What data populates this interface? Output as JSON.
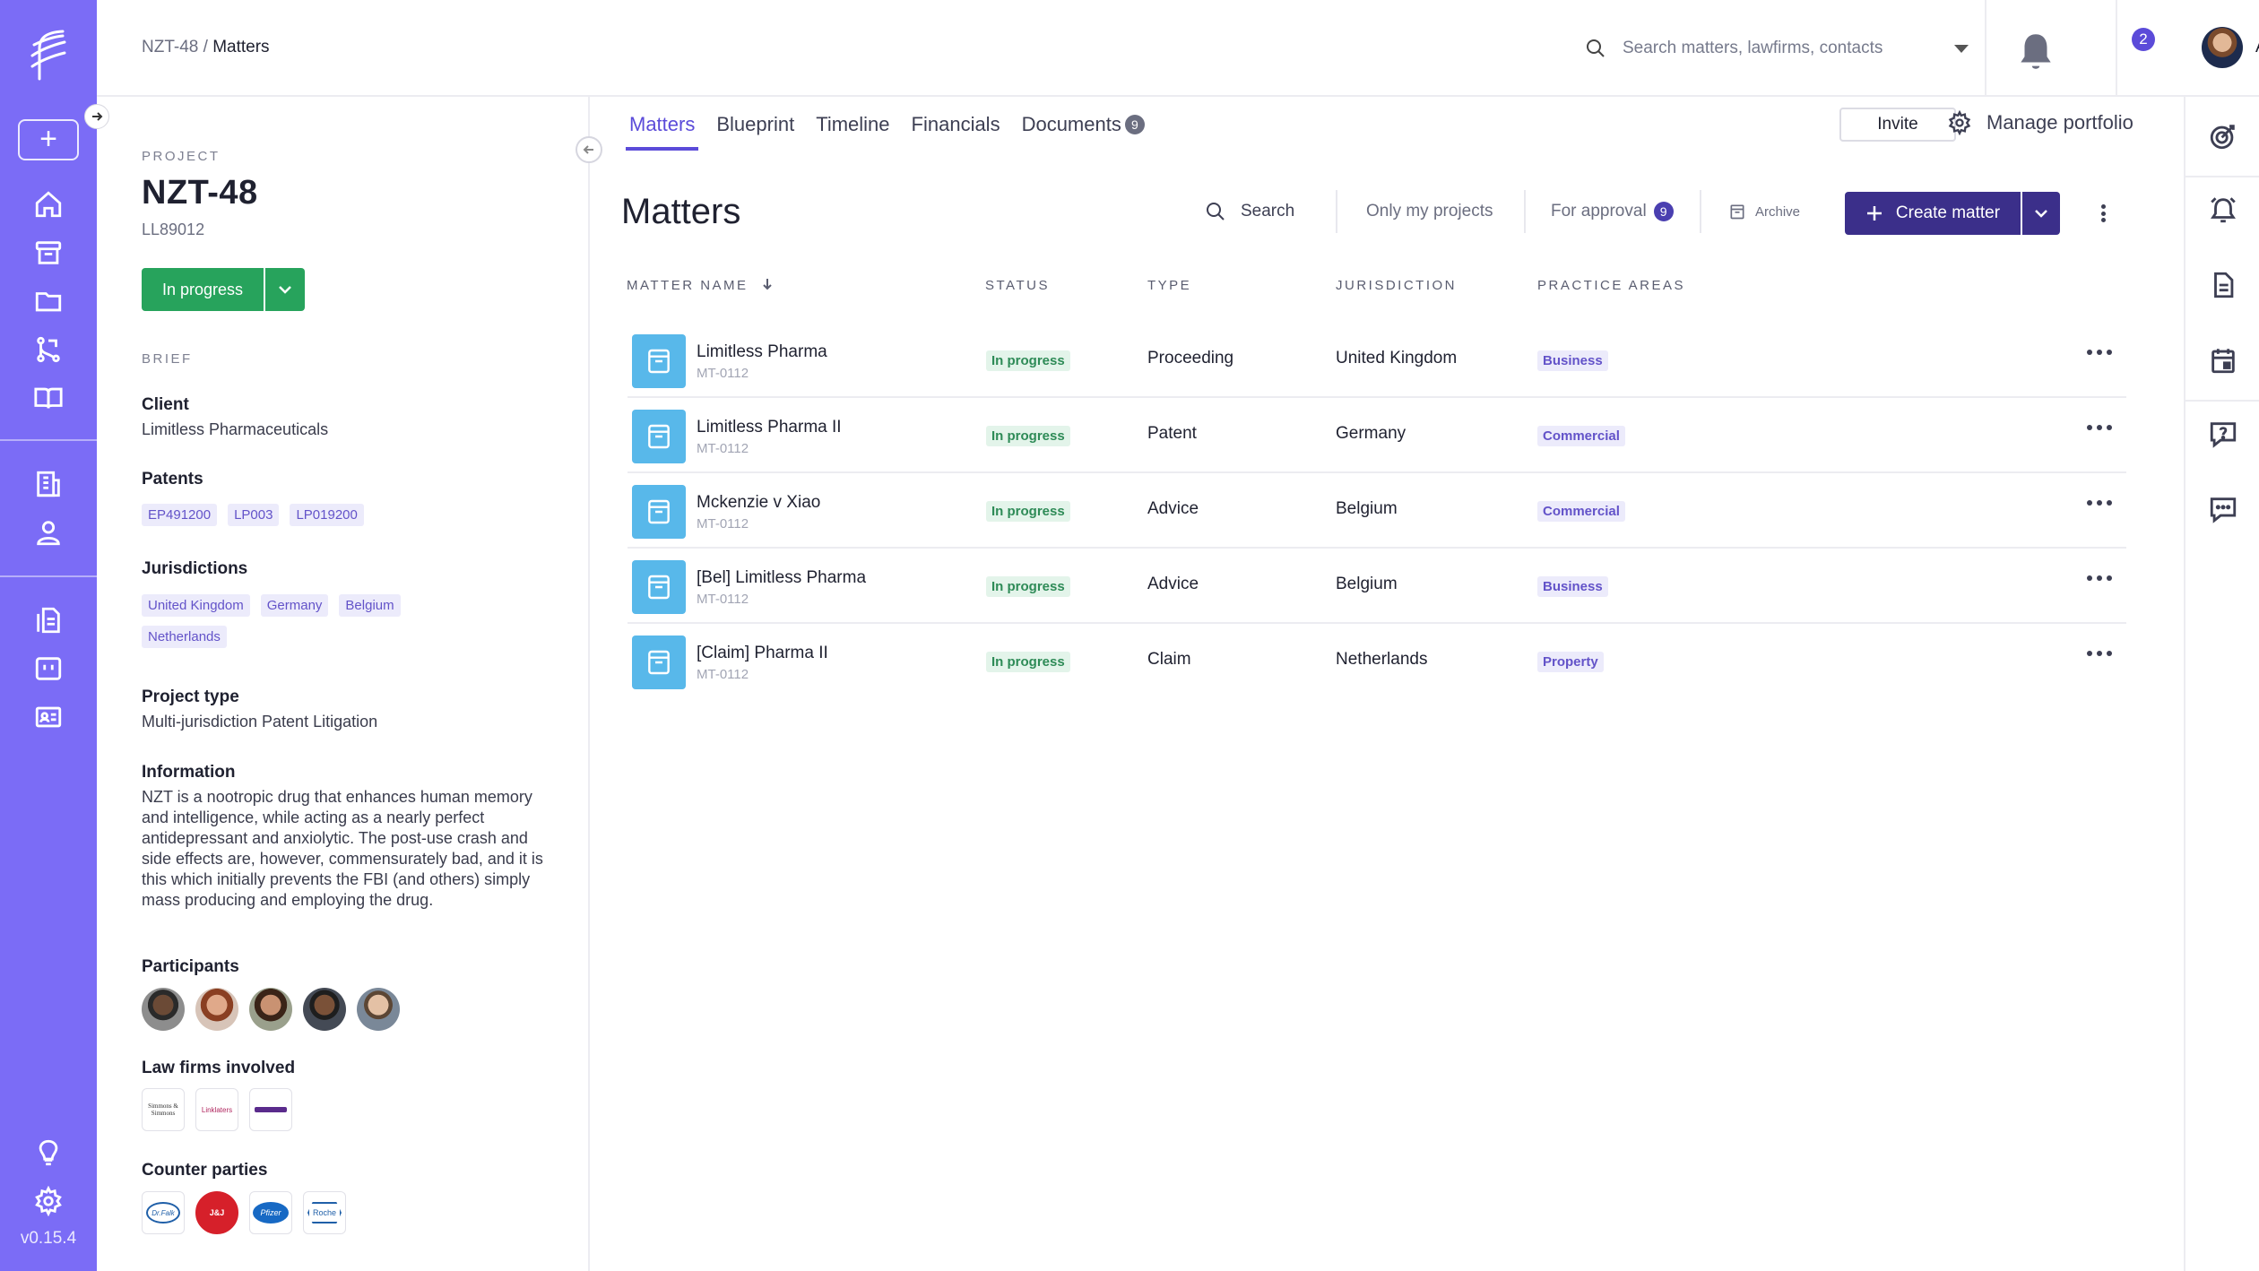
{
  "app": {
    "version": "v0.15.4"
  },
  "breadcrumb": {
    "parent": "NZT-48 /",
    "current": "Matters"
  },
  "global_search": {
    "placeholder": "Search matters, lawfirms, contacts"
  },
  "notifications": {
    "count": "2"
  },
  "user": {
    "initials": "AA"
  },
  "project": {
    "caption": "PROJECT",
    "title": "NZT-48",
    "code": "LL89012",
    "status": "In progress",
    "brief_caption": "BRIEF",
    "client_label": "Client",
    "client": "Limitless Pharmaceuticals",
    "patents_label": "Patents",
    "patents": [
      "EP491200",
      "LP003",
      "LP019200"
    ],
    "jurisdictions_label": "Jurisdictions",
    "jurisdictions": [
      "United Kingdom",
      "Germany",
      "Belgium",
      "Netherlands"
    ],
    "project_type_label": "Project type",
    "project_type": "Multi-jurisdiction Patent Litigation",
    "information_label": "Information",
    "information": "NZT is a nootropic drug that enhances human memory and intelligence, while acting as a nearly perfect antidepressant and anxiolytic. The post-use crash and side effects are, however, commensurately bad, and it is this which initially prevents the FBI (and others) simply mass producing and employing the drug.",
    "participants_label": "Participants",
    "law_firms_label": "Law firms involved",
    "law_firms": [
      "Simmons & Simmons",
      "Linklaters",
      ""
    ],
    "counter_parties_label": "Counter parties",
    "counter_parties": [
      "Dr.Falk",
      "J&J",
      "Pfizer",
      "Roche"
    ]
  },
  "tabs": [
    {
      "label": "Matters",
      "active": true
    },
    {
      "label": "Blueprint"
    },
    {
      "label": "Timeline"
    },
    {
      "label": "Financials"
    },
    {
      "label": "Documents",
      "count": "9"
    }
  ],
  "header_actions": {
    "invite": "Invite",
    "manage": "Manage portfolio"
  },
  "matters": {
    "title": "Matters",
    "toolbar": {
      "search": "Search",
      "only_mine": "Only my projects",
      "for_approval": "For approval",
      "for_approval_count": "9",
      "archive": "Archive",
      "create": "Create matter"
    },
    "columns": [
      "MATTER NAME",
      "STATUS",
      "TYPE",
      "JURISDICTION",
      "PRACTICE AREAS"
    ],
    "rows": [
      {
        "name": "Limitless Pharma",
        "code": "MT-0112",
        "status": "In progress",
        "type": "Proceeding",
        "jurisdiction": "United Kingdom",
        "practice": "Business"
      },
      {
        "name": "Limitless Pharma II",
        "code": "MT-0112",
        "status": "In progress",
        "type": "Patent",
        "jurisdiction": "Germany",
        "practice": "Commercial"
      },
      {
        "name": "Mckenzie v Xiao",
        "code": "MT-0112",
        "status": "In progress",
        "type": "Advice",
        "jurisdiction": "Belgium",
        "practice": "Commercial"
      },
      {
        "name": "[Bel] Limitless Pharma",
        "code": "MT-0112",
        "status": "In progress",
        "type": "Advice",
        "jurisdiction": "Belgium",
        "practice": "Business"
      },
      {
        "name": "[Claim] Pharma II",
        "code": "MT-0112",
        "status": "In progress",
        "type": "Claim",
        "jurisdiction": "Netherlands",
        "practice": "Property"
      }
    ]
  },
  "colors": {
    "rail": "#7b6cf6",
    "accent": "#5b4bd9",
    "primary_button": "#3b2f8a",
    "status_green": "#27a35c",
    "matter_tile": "#58b8ea"
  }
}
